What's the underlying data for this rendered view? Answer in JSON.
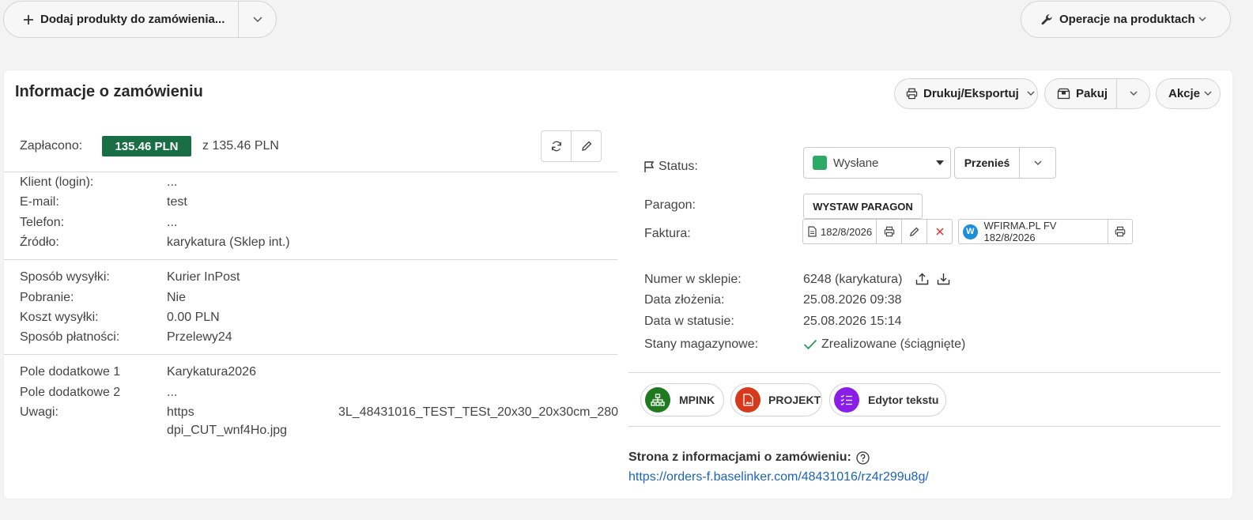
{
  "toolbar": {
    "add_products_label": "Dodaj produkty do zamówienia...",
    "product_operations_label": "Operacje na produktach"
  },
  "order_info": {
    "title": "Informacje o zamówieniu",
    "print_export_label": "Drukuj/Eksportuj",
    "pack_label": "Pakuj",
    "actions_label": "Akcje"
  },
  "payment": {
    "label": "Zapłacono:",
    "paid_badge": "135.46 PLN",
    "total_text": "z 135.46 PLN",
    "badge_color": "#1a6e45"
  },
  "client": [
    {
      "label": "Klient (login):",
      "value": "..."
    },
    {
      "label": "E-mail:",
      "value": "test"
    },
    {
      "label": "Telefon:",
      "value": "..."
    },
    {
      "label": "Źródło:",
      "value": "karykatura (Sklep int.)"
    }
  ],
  "shipping": [
    {
      "label": "Sposób wysyłki:",
      "value": "Kurier InPost"
    },
    {
      "label": "Pobranie:",
      "value": "Nie"
    },
    {
      "label": "Koszt wysyłki:",
      "value": "0.00 PLN"
    },
    {
      "label": "Sposób płatności:",
      "value": "Przelewy24"
    }
  ],
  "extra": {
    "field1_label": "Pole dodatkowe 1",
    "field1_value": "Karykatura2026",
    "field2_label": "Pole dodatkowe 2",
    "field2_value": "...",
    "notes_label": "Uwagi:",
    "notes_line1_start": "https",
    "notes_line1_end": "3L_48431016_TEST_TESt_20x30_20x30cm_280",
    "notes_line2": "dpi_CUT_wnf4Ho.jpg"
  },
  "status": {
    "label": "Status:",
    "value": "Wysłane",
    "color": "#2daa63",
    "move_label": "Przenieś"
  },
  "receipt": {
    "label": "Paragon:",
    "button_label": "WYSTAW PARAGON"
  },
  "invoice": {
    "label": "Faktura:",
    "number": "182/8/2026",
    "wfirma_label": "WFIRMA.PL FV 182/8/2026"
  },
  "details": [
    {
      "label": "Numer w sklepie:",
      "value": "6248 (karykatura)"
    },
    {
      "label": "Data złożenia:",
      "value": "25.08.2026 09:38"
    },
    {
      "label": "Data w statusie:",
      "value": "25.08.2026 15:14"
    },
    {
      "label": "Stany magazynowe:",
      "value": "Zrealizowane (ściągnięte)"
    }
  ],
  "apps": [
    {
      "label": "MPINK",
      "color": "#1f7a1f",
      "icon": "sitemap-icon"
    },
    {
      "label": "PROJEKT",
      "color": "#d63a1c",
      "icon": "image-file-icon"
    },
    {
      "label": "Edytor tekstu",
      "color": "#8a1ee8",
      "icon": "list-check-icon"
    }
  ],
  "order_page": {
    "label": "Strona z informacjami o zamówieniu:",
    "url": "https://orders-f.baselinker.com/48431016/rz4r299u8g/"
  }
}
